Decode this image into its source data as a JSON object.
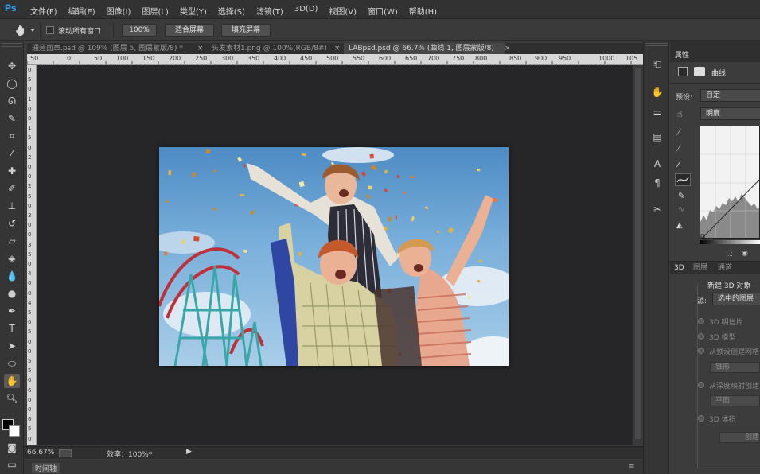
{
  "app": {
    "logo": "Ps"
  },
  "menu": [
    "文件(F)",
    "编辑(E)",
    "图像(I)",
    "图层(L)",
    "类型(Y)",
    "选择(S)",
    "滤镜(T)",
    "3D(D)",
    "视图(V)",
    "窗口(W)",
    "帮助(H)"
  ],
  "options": {
    "scroll_all_label": "滚动所有窗口",
    "zoom_value": "100%",
    "fit_screen": "适合屏幕",
    "fill_screen": "填充屏幕"
  },
  "tabs": [
    {
      "label": "通道面章.psd @ 109% (图层 5, 图层蒙版/8) *",
      "close": "×"
    },
    {
      "label": "头发素材1.png @ 100%(RGB/8#)",
      "close": "×"
    },
    {
      "label": "LABpsd.psd @ 66.7% (曲线 1, 图层蒙版/8)",
      "close": "×"
    }
  ],
  "ruler_top": [
    "50",
    "0",
    "50",
    "100",
    "150",
    "200",
    "250",
    "300",
    "350",
    "400",
    "450",
    "500",
    "550",
    "600",
    "650",
    "700",
    "750",
    "800",
    "850",
    "900",
    "950",
    "1000",
    "105"
  ],
  "ruler_left": [
    "0",
    "5",
    "0",
    "1",
    "0",
    "0",
    "1",
    "5",
    "0",
    "2",
    "0",
    "0",
    "2",
    "5",
    "0",
    "3",
    "0",
    "0",
    "3",
    "5",
    "0",
    "4",
    "0",
    "0",
    "4",
    "5",
    "0",
    "5",
    "0",
    "0",
    "5",
    "5",
    "0",
    "6",
    "0",
    "0",
    "6",
    "5",
    "0"
  ],
  "status": {
    "zoom": "66.67%",
    "efficiency": "效率：100%*",
    "arrow": "▶"
  },
  "timeline": {
    "label": "时间轴"
  },
  "properties": {
    "tab": "属性",
    "title": "曲线",
    "preset_label": "预设:",
    "preset_value": "自定",
    "channel_value": "明度"
  },
  "panel3d": {
    "tabs": [
      "3D",
      "图层",
      "通道"
    ],
    "new_object": "新建 3D 对象",
    "source_label": "源:",
    "source_value": "选中的图层",
    "options": [
      "3D 明信片",
      "3D 模型",
      "从预设创建网格",
      "从深度映射创建"
    ],
    "btn_mesh": "锥形",
    "btn_plane": "平面",
    "volume": "3D 体积",
    "create": "创建"
  },
  "colors": {
    "ps_blue": "#2fa3f0",
    "canvas_bg": "#262628",
    "panel_bg": "#3c3c3c"
  }
}
